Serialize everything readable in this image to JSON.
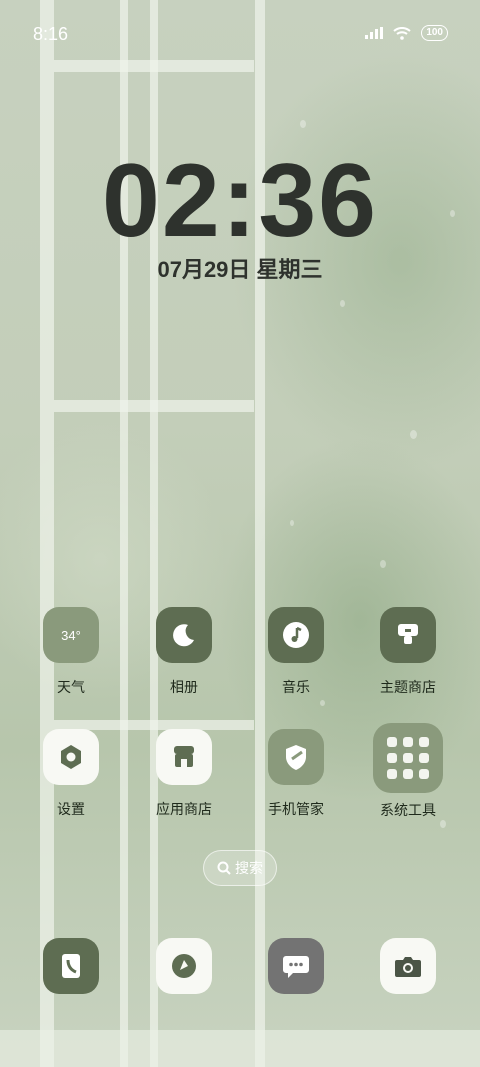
{
  "status_bar": {
    "time": "8:16",
    "battery": "100"
  },
  "lock_clock": {
    "time": "02:36",
    "date": "07月29日 星期三"
  },
  "apps": [
    {
      "label": "天气",
      "temp": "34°"
    },
    {
      "label": "相册"
    },
    {
      "label": "音乐"
    },
    {
      "label": "主题商店"
    },
    {
      "label": "设置"
    },
    {
      "label": "应用商店"
    },
    {
      "label": "手机管家"
    },
    {
      "label": "系统工具"
    }
  ],
  "search": {
    "label": "搜索"
  },
  "dock": [
    "phone",
    "browser",
    "messages",
    "camera"
  ]
}
